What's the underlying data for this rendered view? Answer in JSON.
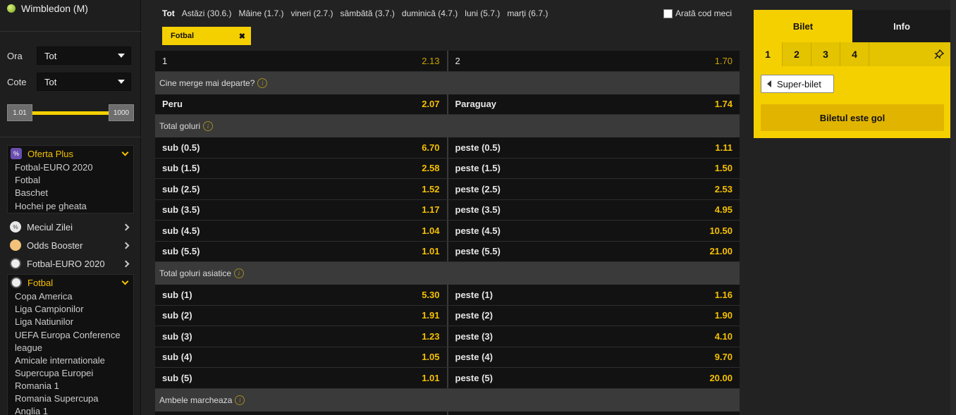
{
  "sidebar": {
    "top_item": "Wimbledon (M)",
    "filters": [
      {
        "label": "Ora",
        "value": "Tot"
      },
      {
        "label": "Cote",
        "value": "Tot"
      }
    ],
    "slider": {
      "min": "1.01",
      "max": "1000"
    },
    "oferta_plus": {
      "title": "Oferta Plus",
      "items": [
        "Fotbal-EURO 2020",
        "Fotbal",
        "Baschet",
        "Hochei pe gheata"
      ]
    },
    "menu": [
      {
        "title": "Meciul Zilei"
      },
      {
        "title": "Odds Booster"
      },
      {
        "title": "Fotbal-EURO 2020"
      }
    ],
    "fotbal": {
      "title": "Fotbal",
      "items": [
        "Copa America",
        "Liga Campionilor",
        "Liga Natiunilor",
        "UEFA Europa Conference league",
        "Amicale internationale",
        "Supercupa Europei",
        "Romania 1",
        "Romania Supercupa",
        "Anglia 1"
      ]
    }
  },
  "daybar": {
    "tot": "Tot",
    "days": [
      "Astăzi (30.6.)",
      "Mâine (1.7.)",
      "vineri (2.7.)",
      "sâmbătă (3.7.)",
      "duminică (4.7.)",
      "luni (5.7.)",
      "marți (6.7.)"
    ],
    "show_code": "Arată cod meci"
  },
  "filter_chip": {
    "label": "Fotbal",
    "close": "✖"
  },
  "markets": {
    "top_row": {
      "left_label": "1",
      "left_val": "2.13",
      "right_label": "2",
      "right_val": "1.70"
    },
    "cine": {
      "title": "Cine merge mai departe?",
      "row": {
        "left_label": "Peru",
        "left_val": "2.07",
        "right_label": "Paraguay",
        "right_val": "1.74"
      }
    },
    "total": {
      "title": "Total goluri",
      "rows": [
        {
          "left_label": "sub (0.5)",
          "left_val": "6.70",
          "right_label": "peste (0.5)",
          "right_val": "1.11"
        },
        {
          "left_label": "sub (1.5)",
          "left_val": "2.58",
          "right_label": "peste (1.5)",
          "right_val": "1.50"
        },
        {
          "left_label": "sub (2.5)",
          "left_val": "1.52",
          "right_label": "peste (2.5)",
          "right_val": "2.53"
        },
        {
          "left_label": "sub (3.5)",
          "left_val": "1.17",
          "right_label": "peste (3.5)",
          "right_val": "4.95"
        },
        {
          "left_label": "sub (4.5)",
          "left_val": "1.04",
          "right_label": "peste (4.5)",
          "right_val": "10.50"
        },
        {
          "left_label": "sub (5.5)",
          "left_val": "1.01",
          "right_label": "peste (5.5)",
          "right_val": "21.00"
        }
      ]
    },
    "asiatice": {
      "title": "Total goluri asiatice",
      "rows": [
        {
          "left_label": "sub (1)",
          "left_val": "5.30",
          "right_label": "peste (1)",
          "right_val": "1.16"
        },
        {
          "left_label": "sub (2)",
          "left_val": "1.91",
          "right_label": "peste (2)",
          "right_val": "1.90"
        },
        {
          "left_label": "sub (3)",
          "left_val": "1.23",
          "right_label": "peste (3)",
          "right_val": "4.10"
        },
        {
          "left_label": "sub (4)",
          "left_val": "1.05",
          "right_label": "peste (4)",
          "right_val": "9.70"
        },
        {
          "left_label": "sub (5)",
          "left_val": "1.01",
          "right_label": "peste (5)",
          "right_val": "20.00"
        }
      ]
    },
    "ambele": {
      "title": "Ambele marcheaza"
    }
  },
  "ticket": {
    "tabs": [
      "Bilet",
      "Info"
    ],
    "numbers": [
      "1",
      "2",
      "3",
      "4"
    ],
    "super_bilet": "Super-bilet",
    "empty": "Biletul este gol"
  },
  "colors": {
    "accent": "#f5d000",
    "odds": "#f5c000"
  }
}
